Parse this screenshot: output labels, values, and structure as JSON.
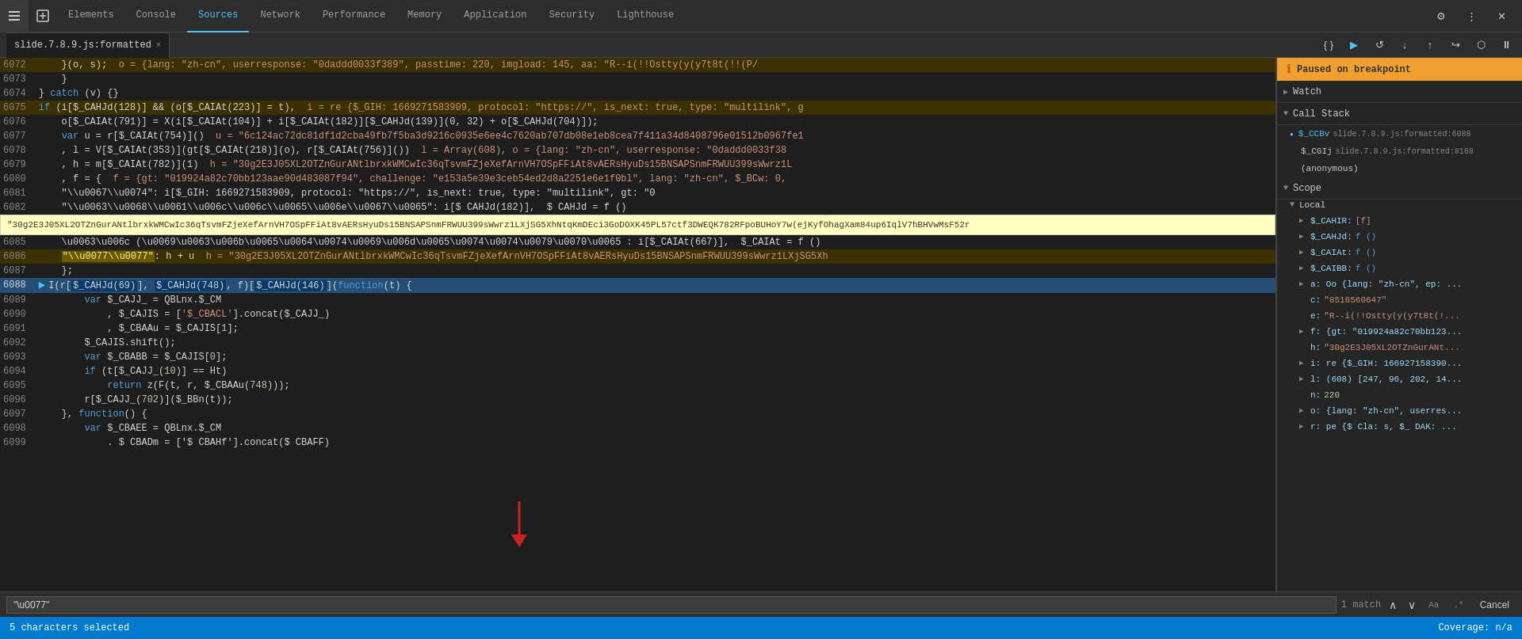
{
  "tabs": {
    "items": [
      {
        "label": "Elements",
        "active": false
      },
      {
        "label": "Console",
        "active": false
      },
      {
        "label": "Sources",
        "active": true
      },
      {
        "label": "Network",
        "active": false
      },
      {
        "label": "Performance",
        "active": false
      },
      {
        "label": "Memory",
        "active": false
      },
      {
        "label": "Application",
        "active": false
      },
      {
        "label": "Security",
        "active": false
      },
      {
        "label": "Lighthouse",
        "active": false
      }
    ]
  },
  "file_tab": {
    "name": "slide.7.8.9.js:formatted",
    "close_label": "×"
  },
  "breakpoint": {
    "label": "Paused on breakpoint"
  },
  "sections": {
    "watch": "Watch",
    "call_stack": "Call Stack",
    "scope": "Scope"
  },
  "call_stack": [
    {
      "name": "$_CCBv",
      "file": "slide.7.8.9.js:formatted:6088",
      "active": true
    },
    {
      "name": "$_CGIj",
      "file": "slide.7.8.9.js:formatted:8168"
    },
    {
      "name": "(anonymous)",
      "file": ""
    }
  ],
  "scope": {
    "title": "Local",
    "items": [
      {
        "key": "$_CAHIR:",
        "val": "[f]",
        "type": "arr"
      },
      {
        "key": "$_CAHJd:",
        "val": "f ()",
        "type": "fn"
      },
      {
        "key": "$_CAIAt:",
        "val": "f ()",
        "type": "fn"
      },
      {
        "key": "$_CAIBB:",
        "val": "f ()",
        "type": "fn"
      },
      {
        "key": "a: Oo {lang: \"zh-cn\", ep: ...",
        "val": "",
        "type": "obj"
      },
      {
        "key": "c:",
        "val": "\"8516560647\"",
        "type": "str"
      },
      {
        "key": "e:",
        "val": "\"R--i(!!Ostty(y(y7t8t(!...",
        "type": "str"
      },
      {
        "key": "f: {gt: \"019924a82c70bb123...",
        "val": "",
        "type": "obj"
      },
      {
        "key": "h:",
        "val": "\"30g2E3J05XL2OTZnGurANt...",
        "type": "str"
      },
      {
        "key": "i: re {$_GIH: 166927158390...",
        "val": "",
        "type": "obj"
      },
      {
        "key": "l: (608) [247, 96, 202, 14...",
        "val": "",
        "type": "arr"
      },
      {
        "key": "n:",
        "val": "220",
        "type": "num"
      },
      {
        "key": "o: {lang: \"zh-cn\", userres...",
        "val": "",
        "type": "obj"
      },
      {
        "key": "r: re {$ Cla: s, $_ DAK: ...",
        "val": "",
        "type": "obj"
      }
    ]
  },
  "code": {
    "lines": [
      {
        "num": "6072",
        "content": "    }(o, s);  o = {lang: \"zh-cn\", userresponse: \"0daddd0033f389\", passtime: 220, imgload: 145, aa: \"R--i(!!Ostty(y(y7t8t(!!(P/",
        "highlight": "yellow"
      },
      {
        "num": "6073",
        "content": "    }",
        "highlight": "none"
      },
      {
        "num": "6074",
        "content": "} catch (v) {}",
        "highlight": "none"
      },
      {
        "num": "6075",
        "content": "if ($_CAHJd(128)] && (o[$_CAIAt(223)] = t),  i = re {$_GIH: 1669271583909, protocol: \"https://\", is_next: true, type: \"multilink\", g",
        "highlight": "yellow"
      },
      {
        "num": "6076",
        "content": "    o[$_CAIAt(791)] = X(i[$_CAIAt(104)] + i[$_CAIAt(182)][$_CAHJd(139)](0, 32) + o[$_CAHJd(704)]);",
        "highlight": "none"
      },
      {
        "num": "6077",
        "content": "    var u = r[$_CAIAt(754)]()  u = \"6c124ac72dc81df1d2cba49fb7f5ba3d9216c0935e6ee4c7620ab707db08e1eb8cea7f411a34d8408796e01512b0967fe1",
        "highlight": "none"
      },
      {
        "num": "6078",
        "content": "    , l = V[$_CAIAt(353)](gt[$_CAIAt(218)](o), r[$_CAIAt(756)]())  l = Array(608), o = {lang: \"zh-cn\", userresponse: \"0daddd0033f389",
        "highlight": "none"
      },
      {
        "num": "6079",
        "content": "    , h = m[$_CAIAt(782)](1)  h = \"30g2E3J05XL2OTZnGurANtlbrxkWMCwIc36qTsvmFZjeXefArnVH7OSpFFiAt8vAERsHyuDs15BNSAPSnmFRWUU399sWwrz1L",
        "highlight": "none"
      },
      {
        "num": "6080",
        "content": "    , f = {  f = {gt: \"019924a82c70bb123aae90d483087f94\", challenge: \"e153a5e39e3ceb54ed2d8a2251e6e1f0bl\", lang: \"zh-cn\", $_BCw: 0,",
        "highlight": "none"
      },
      {
        "num": "6081",
        "content": "    \"\\u0067\\u0074\": i[$_GIH: 1669271583909, protocol: \"https://\", is_next: true, type: \"multilink\", gt: \"0",
        "highlight": "none"
      },
      {
        "num": "6082",
        "content": "    \"\\u0063\\u0068\\u0061\\u006c\\u006c\\u0065\\u006e\\u0067\\u0065\": i[$ CAHJd(182)],  $ CAHJd = f ()",
        "highlight": "none"
      }
    ],
    "tooltip": "\"30g2E3J05XL2OTZnGurANtlbrxkWMCwIc36qTsvmFZjeXefArnVH7OSpFFiAt8vAERsHyuDs15BNSAPSnmFRWUU399sWwrz1LXjSG5XhNtqKmDEci3GoDOXK45PL57ctf3DWEQK782RFpoBUHoY7w(ejKyfOhagXam84up6IqlV7hBHVwMsF52r",
    "lower_lines": [
      {
        "num": "6085",
        "content": "    \\u0063\\u006c \\u0069\\u0063\\u006b\\u0065\\u0064\\u0074\\u0069\\u006d\\u0065\\u0074\\u0074\\u0079\\u0070\\u0065 : i[$_CAIAt(667)],  $_CAIAt = f ()",
        "highlight": "none"
      },
      {
        "num": "6086",
        "content": "    \"\\u0077\\u0077\": h + u  h = \"30g2E3J05XL2OTZnGurANtlbrxkWMCwIc36qTsvmFZjeXefArnVH7OSpFFiAt8vAERsHyuDs15BNSAPSnmFRWUU399sWwrz1LXjSG5Xh",
        "highlight": "yellow-str"
      },
      {
        "num": "6087",
        "content": "    };",
        "highlight": "none"
      },
      {
        "num": "6088",
        "content": "    I(r[$_CAHJd(69)], $_CAHJd(748), f)[$_CAHJd(146)](function(t) {",
        "highlight": "blue"
      },
      {
        "num": "6089",
        "content": "    var $_CAJJ_ = QBLnx.$_CM",
        "highlight": "none"
      },
      {
        "num": "6090",
        "content": "        , $_CAJIS = ['$_CBACL'].concat($_CAJJ_)",
        "highlight": "none"
      },
      {
        "num": "6091",
        "content": "        , $_CBAAu = $_CAJIS[1];",
        "highlight": "none"
      },
      {
        "num": "6092",
        "content": "    $_CAJIS.shift();",
        "highlight": "none"
      },
      {
        "num": "6093",
        "content": "    var $_CBABB = $_CAJIS[0];",
        "highlight": "none"
      },
      {
        "num": "6094",
        "content": "    if (t[$_CAJJ_(10)] == Ht)",
        "highlight": "none"
      },
      {
        "num": "6095",
        "content": "        return z(F(t, r, $_CBAAu(748)));",
        "highlight": "none"
      },
      {
        "num": "6096",
        "content": "    r[$_CAJJ_(702)]($_BBn(t));",
        "highlight": "none"
      },
      {
        "num": "6097",
        "content": "    }, function() {",
        "highlight": "none"
      },
      {
        "num": "6098",
        "content": "    var $_CBAEE = QBLnx.$_CM",
        "highlight": "none"
      },
      {
        "num": "6099",
        "content": "        . $ CBADm = ['$ CBAHf'].concat($ CBAFF)",
        "highlight": "none"
      }
    ]
  },
  "search": {
    "value": "\"\\u0077\"",
    "match_count": "1 match",
    "placeholder": "Find"
  },
  "status": {
    "left": "5 characters selected",
    "right": "Coverage: n/a"
  }
}
